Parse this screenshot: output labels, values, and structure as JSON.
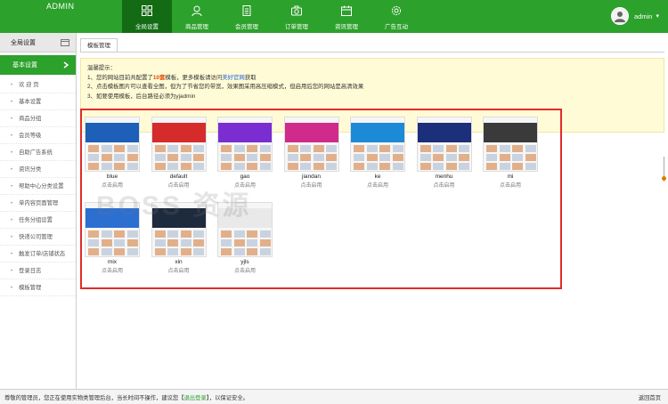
{
  "header": {
    "app_name": "ADMIN",
    "nav": [
      {
        "label": "全局设置",
        "icon": "grid-icon",
        "active": true
      },
      {
        "label": "商品管理",
        "icon": "user-icon",
        "active": false
      },
      {
        "label": "会员管理",
        "icon": "document-icon",
        "active": false
      },
      {
        "label": "订单管理",
        "icon": "camera-icon",
        "active": false
      },
      {
        "label": "资讯管理",
        "icon": "calendar-icon",
        "active": false
      },
      {
        "label": "广告互动",
        "icon": "gear-icon",
        "active": false
      }
    ],
    "user": {
      "name": "admin",
      "dropdown": "▾"
    }
  },
  "sidebar": {
    "title": "全局设置",
    "active_section": "基本设置",
    "items": [
      "欢 迎 页",
      "基本设置",
      "商品分组",
      "会员等级",
      "自助广告系统",
      "资讯分类",
      "帮助中心分类设置",
      "单内容页面管理",
      "任务分组设置",
      "快递公司管理",
      "触发订单/店铺状态",
      "登录日志",
      "模板管理"
    ]
  },
  "main": {
    "tab": "模板管理",
    "notice": {
      "title": "温馨提示：",
      "line1_pre": "1、您的网站目前共配置了",
      "line1_count": "10套",
      "line1_mid": "模板，更多模板请访问",
      "line1_link": "美好官网",
      "line1_post": "获取",
      "line2": "2、点击模板图片可以查看全图，但为了节省您的带宽，效果图采用高压缩模式，但启用后您的网站是高清效果",
      "line3": "3、如要使用模板，后台路径必须为yjadmin"
    },
    "templates": [
      {
        "name": "blue",
        "action": "点击启用",
        "color": "#1e5fb8"
      },
      {
        "name": "default",
        "action": "点击启用",
        "color": "#d62b2b"
      },
      {
        "name": "gao",
        "action": "点击启用",
        "color": "#7a2ed1"
      },
      {
        "name": "jiandan",
        "action": "点击启用",
        "color": "#d02b8a"
      },
      {
        "name": "ke",
        "action": "点击启用",
        "color": "#1d8ad6"
      },
      {
        "name": "menhu",
        "action": "点击启用",
        "color": "#1c2f7a"
      },
      {
        "name": "mi",
        "action": "点击启用",
        "color": "#3a3a3a"
      },
      {
        "name": "mix",
        "action": "点击启用",
        "color": "#2b6fd1"
      },
      {
        "name": "xin",
        "action": "点击启用",
        "color": "#1e2a3d"
      },
      {
        "name": "yjls",
        "action": "点击启用",
        "color": "#e9e9e9"
      }
    ]
  },
  "watermark": "BOSS 资源",
  "footer": {
    "msg_pre": "尊敬的管理员，您正在使用实物类管理后台，当长时间不操作，建议您【",
    "logout": "退出登录",
    "msg_post": "】，以保证安全。",
    "right": "返回首页"
  }
}
